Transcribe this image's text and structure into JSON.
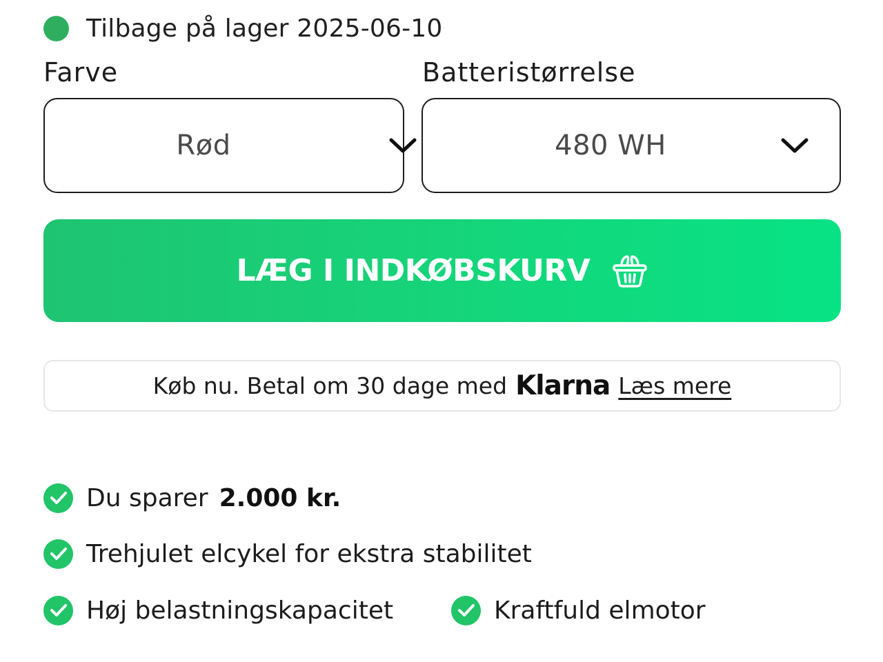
{
  "stock": {
    "status_text": "Tilbage på lager 2025-06-10",
    "status_color": "#2fae5f",
    "icon": "status-dot-icon"
  },
  "options": {
    "color": {
      "label": "Farve",
      "value": "Rød",
      "icon": "chevron-down-icon"
    },
    "battery": {
      "label": "Batteristørrelse",
      "value": "480 WH",
      "icon": "chevron-down-icon"
    }
  },
  "cta": {
    "label": "LÆG I INDKØBSKURV",
    "icon": "basket-icon",
    "accent_color": "#16d47a"
  },
  "klarna": {
    "text": "Køb nu. Betal om 30 dage med",
    "logo": "Klarna",
    "link": "Læs mere"
  },
  "features": [
    {
      "text": "Du sparer",
      "bold": "2.000 kr.",
      "icon": "check-circle-icon"
    },
    {
      "text": "Trehjulet elcykel for ekstra stabilitet",
      "icon": "check-circle-icon"
    },
    {
      "text": "Høj belastningskapacitet",
      "icon": "check-circle-icon"
    },
    {
      "text": "Kraftfuld elmotor",
      "icon": "check-circle-icon"
    }
  ],
  "colors": {
    "check_green": "#22c468",
    "border": "#1c1c1c"
  }
}
